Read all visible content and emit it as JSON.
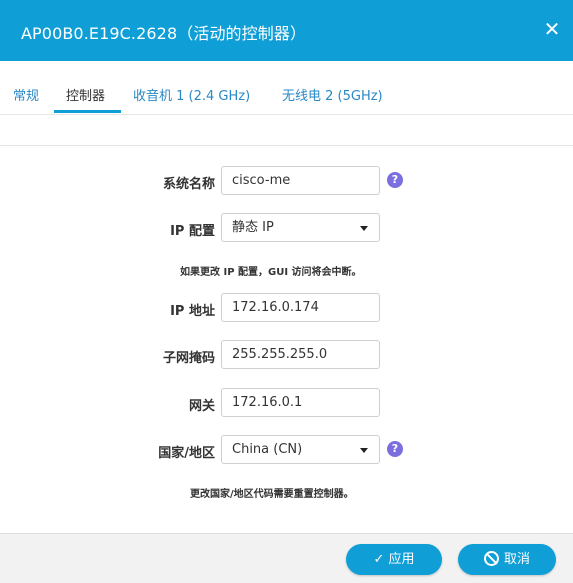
{
  "dialog": {
    "title": "AP00B0.E19C.2628（活动的控制器）",
    "close_glyph": "✕"
  },
  "tabs": [
    {
      "label": "常规"
    },
    {
      "label": "控制器"
    },
    {
      "label": "收音机 1 (2.4 GHz)"
    },
    {
      "label": "无线电 2 (5GHz)"
    }
  ],
  "form": {
    "system_name": {
      "label": "系统名称",
      "value": "cisco-me"
    },
    "ip_config": {
      "label": "IP 配置",
      "value": "静态 IP"
    },
    "ip_note": "如果更改 IP 配置，GUI 访问将会中断。",
    "ip_address": {
      "label": "IP 地址",
      "value": "172.16.0.174"
    },
    "subnet_mask": {
      "label": "子网掩码",
      "value": "255.255.255.0"
    },
    "gateway": {
      "label": "网关",
      "value": "172.16.0.1"
    },
    "country": {
      "label": "国家/地区",
      "value": "China (CN)"
    },
    "country_note": "更改国家/地区代码需要重置控制器。"
  },
  "help_glyph": "?",
  "buttons": {
    "apply": "应用",
    "cancel": "取消"
  },
  "colors": {
    "header": "#0f9ed6",
    "tab_link": "#2a88c5",
    "help_icon": "#7b6fe0",
    "button": "#0f9ed6"
  }
}
